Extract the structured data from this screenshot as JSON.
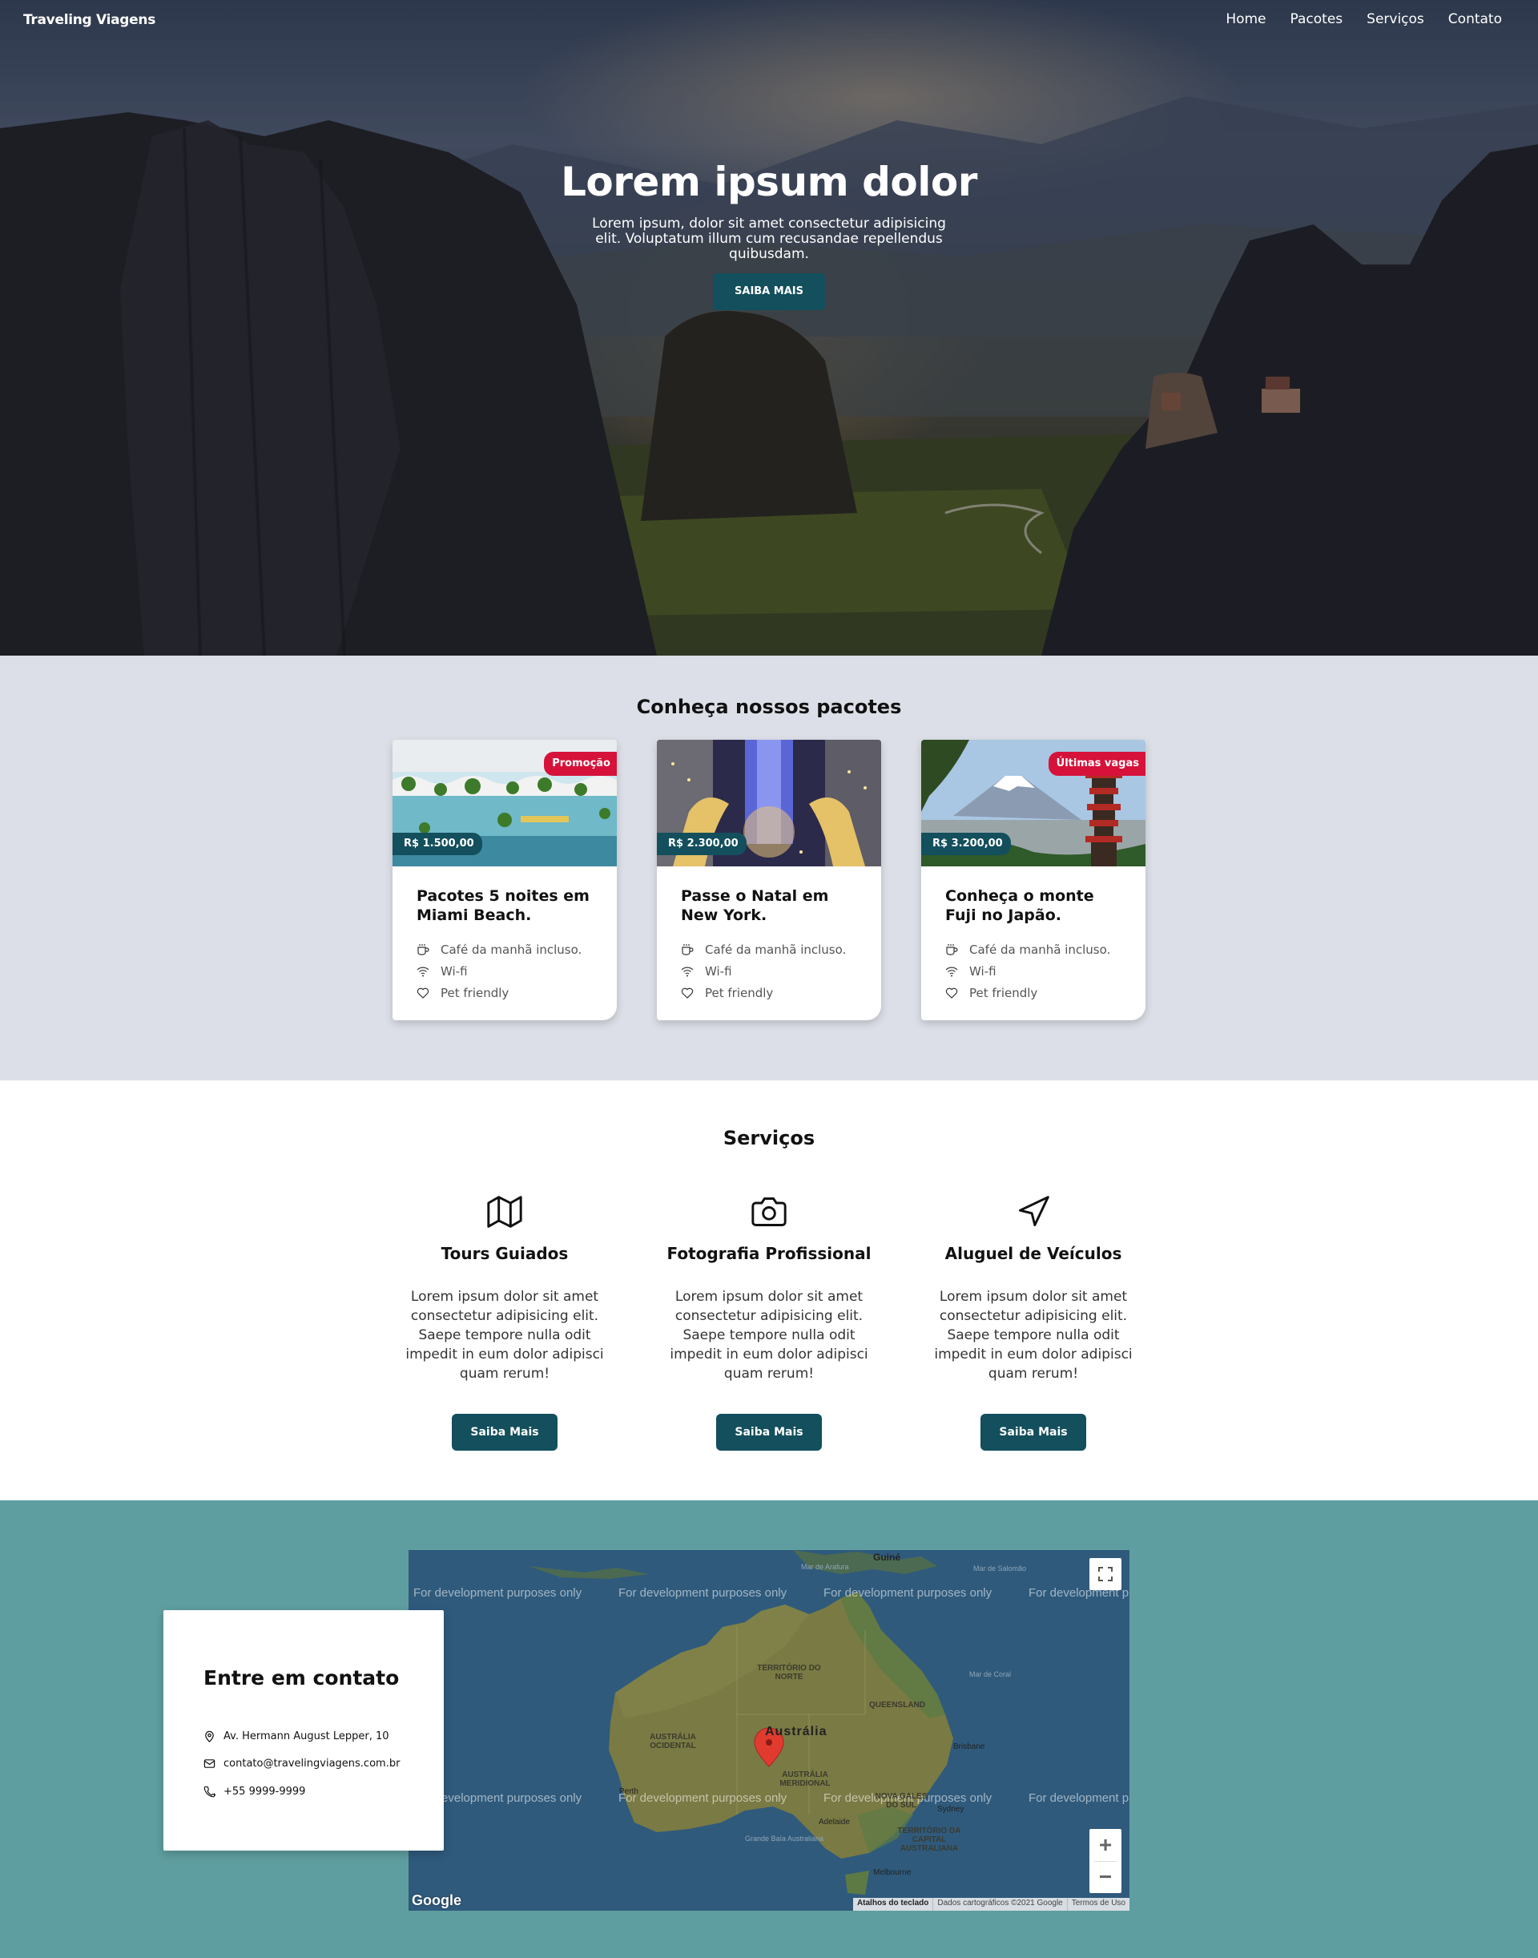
{
  "nav": {
    "brand": "Traveling Viagens",
    "links": [
      "Home",
      "Pacotes",
      "Serviços",
      "Contato"
    ]
  },
  "hero": {
    "title": "Lorem ipsum dolor",
    "subtitle": "Lorem ipsum, dolor sit amet consectetur adipisicing elit. Voluptatum illum cum recusandae repellendus quibusdam.",
    "button": "SAIBA MAIS"
  },
  "packages": {
    "title": "Conheça nossos pacotes",
    "cards": [
      {
        "price": "R$ 1.500,00",
        "badge": "Promoção",
        "title": "Pacotes 5 noites em Miami Beach.",
        "features": [
          {
            "icon": "coffee-icon",
            "label": "Café da manhã incluso."
          },
          {
            "icon": "wifi-icon",
            "label": "Wi-fi"
          },
          {
            "icon": "heart-icon",
            "label": "Pet friendly"
          }
        ]
      },
      {
        "price": "R$ 2.300,00",
        "badge": "",
        "title": "Passe o Natal em New York.",
        "features": [
          {
            "icon": "coffee-icon",
            "label": "Café da manhã incluso."
          },
          {
            "icon": "wifi-icon",
            "label": "Wi-fi"
          },
          {
            "icon": "heart-icon",
            "label": "Pet friendly"
          }
        ]
      },
      {
        "price": "R$ 3.200,00",
        "badge": "Últimas vagas",
        "title": "Conheça o monte Fuji no Japão.",
        "features": [
          {
            "icon": "coffee-icon",
            "label": "Café da manhã incluso."
          },
          {
            "icon": "wifi-icon",
            "label": "Wi-fi"
          },
          {
            "icon": "heart-icon",
            "label": "Pet friendly"
          }
        ]
      }
    ]
  },
  "services": {
    "title": "Serviços",
    "items": [
      {
        "icon": "map-icon",
        "title": "Tours Guiados",
        "text": "Lorem ipsum dolor sit amet consectetur adipisicing elit. Saepe tempore nulla odit impedit in eum dolor adipisci quam rerum!",
        "button": "Saiba Mais"
      },
      {
        "icon": "camera-icon",
        "title": "Fotografia Profissional",
        "text": "Lorem ipsum dolor sit amet consectetur adipisicing elit. Saepe tempore nulla odit impedit in eum dolor adipisci quam rerum!",
        "button": "Saiba Mais"
      },
      {
        "icon": "navigation-icon",
        "title": "Aluguel de Veículos",
        "text": "Lorem ipsum dolor sit amet consectetur adipisicing elit. Saepe tempore nulla odit impedit in eum dolor adipisci quam rerum!",
        "button": "Saiba Mais"
      }
    ]
  },
  "contact": {
    "title": "Entre em contato",
    "address": "Av. Hermann August Lepper, 10",
    "email": "contato@travelingviagens.com.br",
    "phone": "+55 9999-9999"
  },
  "map": {
    "dev_notice": "For development purposes only",
    "country": "Austrália",
    "regions": [
      "TERRITÓRIO DO NORTE",
      "QUEENSLAND",
      "AUSTRÁLIA OCIDENTAL",
      "AUSTRÁLIA MERIDIONAL",
      "NOVA GALES DO SUL",
      "TERRITÓRIO DA CAPITAL AUSTRALIANA"
    ],
    "cities": [
      "Brisbane",
      "Perth",
      "Adelaide",
      "Sydney",
      "Melbourne"
    ],
    "places": [
      "Guiné",
      "Mar de Arafura",
      "Mar de Salomão",
      "Mar de Coral",
      "Grande Baía Australiana"
    ],
    "zoom_in": "+",
    "zoom_out": "−",
    "logo": "Google",
    "footer": [
      "Atalhos do teclado",
      "Dados cartográficos ©2021 Google",
      "Termos de Uso"
    ]
  }
}
